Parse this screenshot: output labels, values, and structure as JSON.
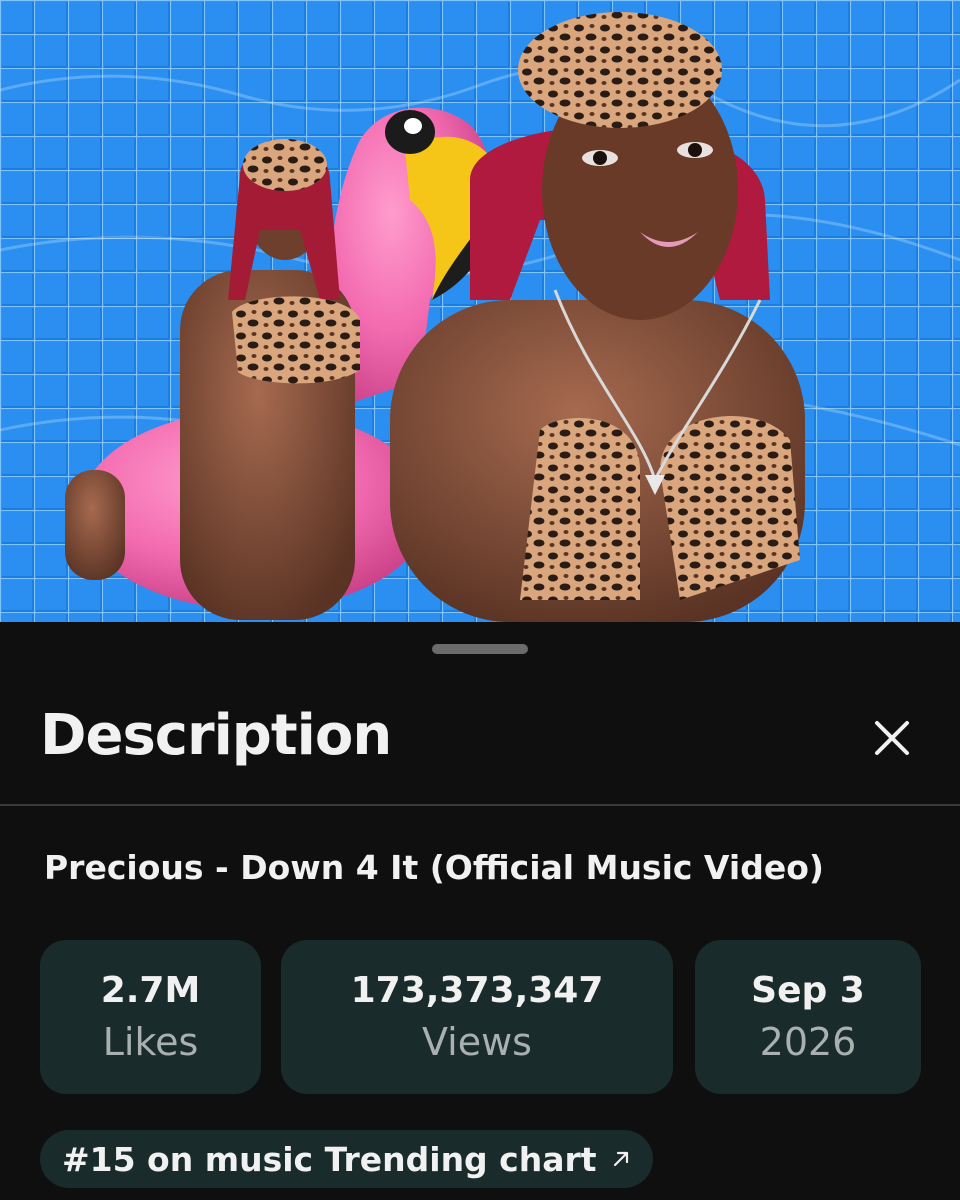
{
  "video": {
    "thumbnail_icon": "music-video-frame"
  },
  "sheet": {
    "title": "Description",
    "close_icon": "close-icon"
  },
  "details": {
    "video_title": "Precious - Down 4 It (Official Music Video)",
    "stats": {
      "likes": {
        "value": "2.7M",
        "label": "Likes"
      },
      "views": {
        "value": "173,373,347",
        "label": "Views"
      },
      "date": {
        "value": "Sep 3",
        "label": "2026"
      }
    },
    "trending_chip": {
      "label": "#15 on music Trending chart",
      "icon": "arrow-up-right-icon"
    }
  },
  "colors": {
    "background": "#0f0f0f",
    "card": "#1a2b2b",
    "text_primary": "#f1f1f1",
    "text_secondary": "#a9b0b0",
    "pool_blue": "#1a78d6",
    "flamingo_pink": "#f36bb0"
  }
}
